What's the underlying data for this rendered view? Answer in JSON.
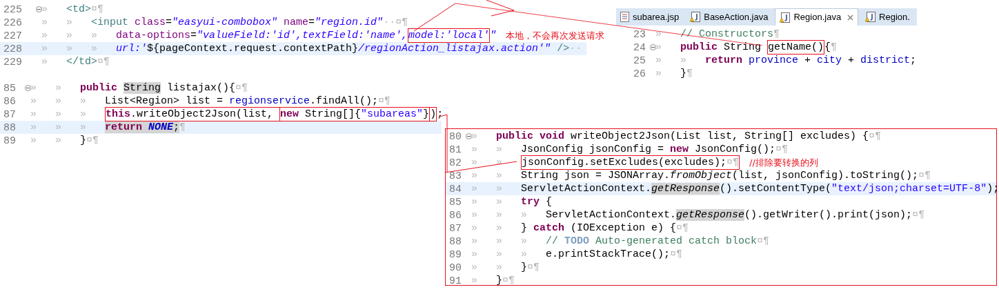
{
  "jsp_editor": {
    "lines": [
      {
        "number": "225",
        "foldable": true,
        "current": false,
        "tabs": [
          "»"
        ],
        "tokens": [
          {
            "kind": "tag",
            "text": "<td>"
          },
          {
            "kind": "ws",
            "text": "¤¶"
          }
        ]
      },
      {
        "number": "226",
        "foldable": false,
        "current": false,
        "tabs": [
          "»",
          "»"
        ],
        "tokens": [
          {
            "kind": "tag",
            "text": "<input "
          },
          {
            "kind": "attr",
            "text": "class"
          },
          {
            "kind": "plain",
            "text": "="
          },
          {
            "kind": "aval",
            "text": "\"easyui-combobox\" "
          },
          {
            "kind": "attr",
            "text": "name"
          },
          {
            "kind": "plain",
            "text": "="
          },
          {
            "kind": "aval",
            "text": "\"region.id\""
          },
          {
            "kind": "ws",
            "text": "··¤¶"
          }
        ]
      },
      {
        "number": "227",
        "foldable": false,
        "current": false,
        "tabs": [
          "»",
          "»",
          "»"
        ],
        "note": "本地，不会再次发送请求",
        "tokens": [
          {
            "kind": "attr",
            "text": "data-options"
          },
          {
            "kind": "plain",
            "text": "="
          },
          {
            "kind": "aval",
            "text": "\"valueField:'id',textField:'name',"
          },
          {
            "kind": "box",
            "tokens": [
              {
                "kind": "aval",
                "text": "model:'local'"
              }
            ]
          },
          {
            "kind": "aval",
            "text": "\""
          }
        ]
      },
      {
        "number": "228",
        "foldable": false,
        "current": true,
        "tabs": [
          "»",
          "»",
          "»"
        ],
        "tokens": [
          {
            "kind": "aval",
            "text": "url:'"
          },
          {
            "kind": "plain",
            "text": "${pageContext.request.contextPath}"
          },
          {
            "kind": "aval",
            "text": "/regionAction_listajax.action'\""
          },
          {
            "kind": "tag",
            "text": " />"
          },
          {
            "kind": "ws",
            "text": "··"
          }
        ]
      },
      {
        "number": "229",
        "foldable": false,
        "current": false,
        "tabs": [
          "»"
        ],
        "tokens": [
          {
            "kind": "tag",
            "text": "</td>"
          },
          {
            "kind": "ws",
            "text": "¤¶"
          }
        ]
      }
    ]
  },
  "region_editor": {
    "tabs": [
      {
        "label": "subarea.jsp",
        "kind": "jsp",
        "selected": false
      },
      {
        "label": "BaseAction.java",
        "kind": "java",
        "selected": false
      },
      {
        "label": "Region.java",
        "kind": "java",
        "selected": true
      },
      {
        "label": "Region.",
        "kind": "java",
        "selected": false
      }
    ],
    "lines": [
      {
        "number": "23",
        "foldable": false,
        "current": false,
        "tabs": [
          "»"
        ],
        "tokens": [
          {
            "kind": "comment",
            "text": "// Constructors"
          },
          {
            "kind": "ws",
            "text": "¶"
          }
        ]
      },
      {
        "number": "24",
        "foldable": true,
        "current": false,
        "tabs": [
          "»"
        ],
        "tokens": [
          {
            "kind": "kw",
            "text": "public"
          },
          {
            "kind": "plain",
            "text": " String "
          },
          {
            "kind": "box",
            "tokens": [
              {
                "kind": "plain",
                "text": "getName()"
              }
            ]
          },
          {
            "kind": "plain",
            "text": "{"
          },
          {
            "kind": "ws",
            "text": "¶"
          }
        ]
      },
      {
        "number": "25",
        "foldable": false,
        "current": false,
        "tabs": [
          "»",
          "»"
        ],
        "tokens": [
          {
            "kind": "kw",
            "text": "return "
          },
          {
            "kind": "field",
            "text": "province"
          },
          {
            "kind": "plain",
            "text": " + "
          },
          {
            "kind": "field",
            "text": "city"
          },
          {
            "kind": "plain",
            "text": " + "
          },
          {
            "kind": "field",
            "text": "district"
          },
          {
            "kind": "plain",
            "text": ";"
          }
        ]
      },
      {
        "number": "26",
        "foldable": false,
        "current": false,
        "tabs": [
          "»"
        ],
        "tokens": [
          {
            "kind": "plain",
            "text": "}"
          },
          {
            "kind": "ws",
            "text": "¶"
          }
        ]
      }
    ]
  },
  "action_editor": {
    "lines": [
      {
        "number": "85",
        "foldable": true,
        "current": false,
        "tabs": [
          "»",
          "»"
        ],
        "tokens": [
          {
            "kind": "kw",
            "text": "public "
          },
          {
            "kind": "highlight",
            "tokens": [
              {
                "kind": "plain",
                "text": "String"
              }
            ]
          },
          {
            "kind": "plain",
            "text": " listajax(){"
          },
          {
            "kind": "ws",
            "text": "¤¶"
          }
        ]
      },
      {
        "number": "86",
        "foldable": false,
        "current": false,
        "tabs": [
          "»",
          "»",
          "»"
        ],
        "tokens": [
          {
            "kind": "plain",
            "text": "List<Region> list = "
          },
          {
            "kind": "field",
            "text": "regionservice"
          },
          {
            "kind": "plain",
            "text": ".findAll();"
          },
          {
            "kind": "ws",
            "text": "¤¶"
          }
        ]
      },
      {
        "number": "87",
        "foldable": false,
        "current": false,
        "tabs": [
          "»",
          "»",
          "»"
        ],
        "tokens": [
          {
            "kind": "box",
            "tokens": [
              {
                "kind": "kw",
                "text": "this"
              },
              {
                "kind": "plain",
                "text": ".writeObject2Json(list, "
              },
              {
                "kind": "box",
                "tokens": [
                  {
                    "kind": "kw",
                    "text": "new"
                  },
                  {
                    "kind": "plain",
                    "text": " String[]{"
                  },
                  {
                    "kind": "str",
                    "text": "\"subareas\""
                  },
                  {
                    "kind": "plain",
                    "text": "}"
                  }
                ]
              },
              {
                "kind": "plain",
                "text": ")"
              }
            ]
          },
          {
            "kind": "plain",
            "text": ";"
          }
        ]
      },
      {
        "number": "88",
        "foldable": false,
        "current": true,
        "tabs": [
          "»",
          "»",
          "»"
        ],
        "tokens": [
          {
            "kind": "highlight",
            "tokens": [
              {
                "kind": "kw",
                "text": "return "
              },
              {
                "kind": "const",
                "text": "NONE"
              },
              {
                "kind": "plain",
                "text": ";"
              }
            ]
          },
          {
            "kind": "ws",
            "text": "¶"
          }
        ]
      },
      {
        "number": "89",
        "foldable": false,
        "current": false,
        "tabs": [
          "»",
          "»"
        ],
        "tokens": [
          {
            "kind": "plain",
            "text": "}"
          },
          {
            "kind": "ws",
            "text": "¤¶"
          }
        ]
      }
    ]
  },
  "base_editor": {
    "lines": [
      {
        "number": "80",
        "foldable": true,
        "current": false,
        "tabs": [
          "»"
        ],
        "tokens": [
          {
            "kind": "kw",
            "text": "public void"
          },
          {
            "kind": "plain",
            "text": " writeObject2Json(List list, String[] excludes) {"
          },
          {
            "kind": "ws",
            "text": "¤¶"
          }
        ]
      },
      {
        "number": "81",
        "foldable": false,
        "current": false,
        "tabs": [
          "»",
          "»"
        ],
        "tokens": [
          {
            "kind": "plain",
            "text": "JsonConfig jsonConfig = "
          },
          {
            "kind": "kw",
            "text": "new"
          },
          {
            "kind": "plain",
            "text": " JsonConfig();"
          },
          {
            "kind": "ws",
            "text": "¤¶"
          }
        ]
      },
      {
        "number": "82",
        "foldable": false,
        "current": false,
        "tabs": [
          "»",
          "»"
        ],
        "note": "//排除要转换的列",
        "tokens": [
          {
            "kind": "box",
            "tokens": [
              {
                "kind": "plain",
                "text": "jsonConfig.setExcludes(excludes);"
              },
              {
                "kind": "ws",
                "text": "¤¶"
              }
            ]
          }
        ]
      },
      {
        "number": "83",
        "foldable": false,
        "current": false,
        "tabs": [
          "»",
          "»"
        ],
        "tokens": [
          {
            "kind": "plain",
            "text": "String json = JSONArray."
          },
          {
            "kind": "italic",
            "text": "fromObject"
          },
          {
            "kind": "plain",
            "text": "(list, jsonConfig).toString();"
          },
          {
            "kind": "ws",
            "text": "¤¶"
          }
        ]
      },
      {
        "number": "84",
        "foldable": false,
        "current": true,
        "tabs": [
          "»",
          "»"
        ],
        "tokens": [
          {
            "kind": "plain",
            "text": "ServletActionContext."
          },
          {
            "kind": "highlight",
            "tokens": [
              {
                "kind": "italic",
                "text": "getResponse"
              }
            ]
          },
          {
            "kind": "plain",
            "text": "().setContentType("
          },
          {
            "kind": "str",
            "text": "\"text/json;charset=UTF-8\""
          },
          {
            "kind": "plain",
            "text": ");"
          }
        ]
      },
      {
        "number": "85",
        "foldable": false,
        "current": false,
        "tabs": [
          "»",
          "»"
        ],
        "tokens": [
          {
            "kind": "kw",
            "text": "try"
          },
          {
            "kind": "plain",
            "text": " {"
          }
        ]
      },
      {
        "number": "86",
        "foldable": false,
        "current": false,
        "tabs": [
          "»",
          "»",
          "»"
        ],
        "tokens": [
          {
            "kind": "plain",
            "text": "ServletActionContext."
          },
          {
            "kind": "highlight",
            "tokens": [
              {
                "kind": "italic",
                "text": "getResponse"
              }
            ]
          },
          {
            "kind": "plain",
            "text": "().getWriter().print(json);"
          },
          {
            "kind": "ws",
            "text": "¤¶"
          }
        ]
      },
      {
        "number": "87",
        "foldable": false,
        "current": false,
        "tabs": [
          "»",
          "»"
        ],
        "tokens": [
          {
            "kind": "plain",
            "text": "} "
          },
          {
            "kind": "kw",
            "text": "catch"
          },
          {
            "kind": "plain",
            "text": " (IOException e) {"
          },
          {
            "kind": "ws",
            "text": "¤¶"
          }
        ]
      },
      {
        "number": "88",
        "foldable": false,
        "current": false,
        "tabs": [
          "»",
          "»",
          "»"
        ],
        "tokens": [
          {
            "kind": "comment",
            "text": "// "
          },
          {
            "kind": "todo",
            "text": "TODO"
          },
          {
            "kind": "comment",
            "text": " Auto-generated catch block"
          },
          {
            "kind": "ws",
            "text": "¤¶"
          }
        ]
      },
      {
        "number": "89",
        "foldable": false,
        "current": false,
        "tabs": [
          "»",
          "»",
          "»"
        ],
        "tokens": [
          {
            "kind": "plain",
            "text": "e.printStackTrace();"
          },
          {
            "kind": "ws",
            "text": "¤¶"
          }
        ]
      },
      {
        "number": "90",
        "foldable": false,
        "current": false,
        "tabs": [
          "»",
          "»"
        ],
        "tokens": [
          {
            "kind": "plain",
            "text": "}"
          },
          {
            "kind": "ws",
            "text": "¤¶"
          }
        ]
      },
      {
        "number": "91",
        "foldable": false,
        "current": false,
        "tabs": [
          "»"
        ],
        "tokens": [
          {
            "kind": "plain",
            "text": "}"
          },
          {
            "kind": "ws",
            "text": "¤¶"
          }
        ]
      }
    ]
  }
}
